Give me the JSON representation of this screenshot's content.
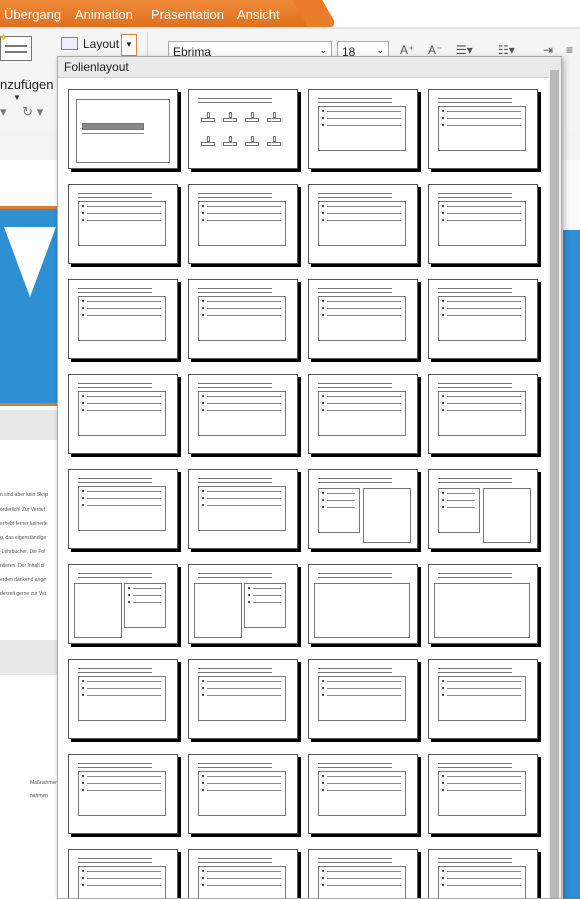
{
  "menubar": {
    "items": [
      "Übergang",
      "Animation",
      "Präsentation",
      "Ansicht"
    ]
  },
  "toolbar": {
    "insert_label": "nzufügen",
    "layout_label": "Layout",
    "font_name": "Ebrima",
    "font_size": "18"
  },
  "popup": {
    "title": "Folienlayout",
    "layouts": [
      "title",
      "icons",
      "text",
      "text",
      "text",
      "text",
      "text",
      "text",
      "text",
      "text",
      "text",
      "text",
      "text",
      "text",
      "text",
      "text",
      "text",
      "text",
      "text-right-box",
      "text-right-box",
      "box-left-text",
      "box-left-text-box",
      "title-box",
      "title-box",
      "text",
      "text",
      "text",
      "text",
      "text",
      "text",
      "text",
      "text",
      "text",
      "text",
      "text",
      "text"
    ]
  },
  "background": {
    "snippets": [
      "n sind aber kein Skrip",
      "orderlich! Zur Vertief",
      "erhebt ferner keinerle",
      "g, das eigenständige",
      "-Lehrbücher. Die Fol",
      "ntieren. Der Inhalt d",
      "erden dankend ange",
      "derzeit gerne zur Ver",
      "Maßnahmen",
      "nahmen"
    ]
  }
}
